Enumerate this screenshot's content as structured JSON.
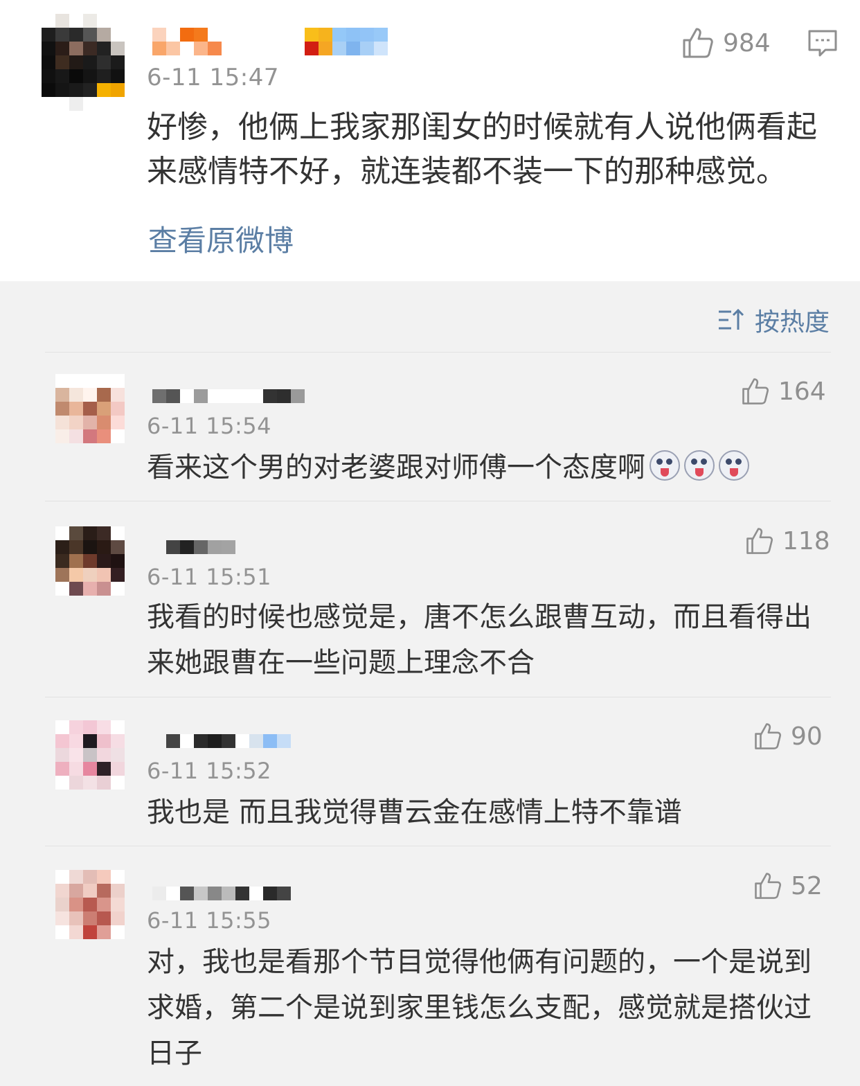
{
  "main_post": {
    "timestamp": "6-11 15:47",
    "likes": "984",
    "text": "好惨，他俩上我家那闺女的时候就有人说他俩看起来感情特不好，就连装都不装一下的那种感觉。",
    "view_original": "查看原微博"
  },
  "sort": {
    "label": "按热度"
  },
  "comments": [
    {
      "timestamp": "6-11 15:54",
      "likes": "164",
      "text": "看来这个男的对老婆跟对师傅一个态度啊"
    },
    {
      "timestamp": "6-11 15:51",
      "likes": "118",
      "text": "我看的时候也感觉是，唐不怎么跟曹互动，而且看得出来她跟曹在一些问题上理念不合"
    },
    {
      "timestamp": "6-11 15:52",
      "likes": "90",
      "text": "我也是 而且我觉得曹云金在感情上特不靠谱"
    },
    {
      "timestamp": "6-11 15:55",
      "likes": "52",
      "text": "对，我也是看那个节目觉得他俩有问题的，一个是说到求婚，第二个是说到家里钱怎么支配，感觉就是搭伙过日子"
    }
  ],
  "colors": {
    "link": "#5b7ea4",
    "time": "#939393",
    "text": "#333333",
    "background": "#f2f2f2"
  },
  "icons": [
    "thumbs-up-icon",
    "comment-icon",
    "sort-icon",
    "emoji-icon"
  ]
}
